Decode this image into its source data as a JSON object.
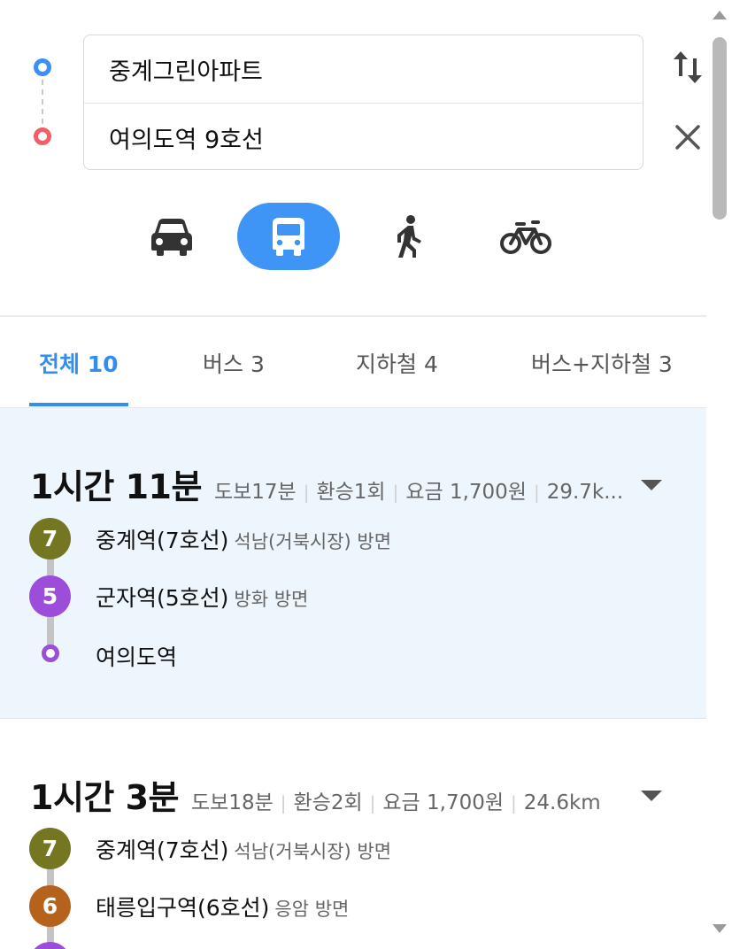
{
  "search": {
    "origin": "중계그린아파트",
    "destination": "여의도역 9호선"
  },
  "modes": [
    {
      "icon": "car-icon",
      "active": false
    },
    {
      "icon": "bus-icon",
      "active": true
    },
    {
      "icon": "walk-icon",
      "active": false
    },
    {
      "icon": "bike-icon",
      "active": false
    }
  ],
  "tabs": [
    {
      "label": "전체 10",
      "active": true
    },
    {
      "label": "버스 3",
      "active": false
    },
    {
      "label": "지하철 4",
      "active": false
    },
    {
      "label": "버스+지하철 3",
      "active": false
    }
  ],
  "routes": [
    {
      "time": "1시간 11분",
      "walk": "도보17분",
      "transfers": "환승1회",
      "fare": "요금 1,700원",
      "distance": "29.7k...",
      "steps": [
        {
          "badge": "7",
          "color": "#747622",
          "station": "중계역(7호선)",
          "direction": "석남(거북시장) 방면"
        },
        {
          "badge": "5",
          "color": "#9c4dd9",
          "station": "군자역(5호선)",
          "direction": "방화 방면"
        },
        {
          "badge": "",
          "color": "#9c4dd9",
          "station": "여의도역",
          "direction": ""
        }
      ]
    },
    {
      "time": "1시간 3분",
      "walk": "도보18분",
      "transfers": "환승2회",
      "fare": "요금 1,700원",
      "distance": "24.6km",
      "steps": [
        {
          "badge": "7",
          "color": "#747622",
          "station": "중계역(7호선)",
          "direction": "석남(거북시장) 방면"
        },
        {
          "badge": "6",
          "color": "#b5621c",
          "station": "태릉입구역(6호선)",
          "direction": "응암 방면"
        }
      ]
    }
  ],
  "colors": {
    "accent": "#2e8ef2",
    "route_bg": "#eef6fd",
    "origin_dot": "#3b8ff5",
    "destination_dot": "#f25d68"
  }
}
